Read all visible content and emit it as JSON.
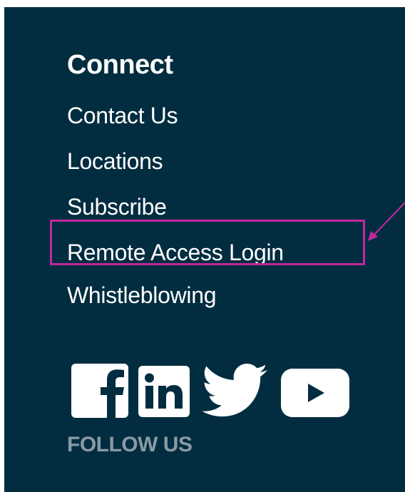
{
  "connect": {
    "heading": "Connect",
    "links": [
      {
        "label": "Contact Us"
      },
      {
        "label": "Locations"
      },
      {
        "label": "Subscribe"
      },
      {
        "label": "Remote Access Login"
      },
      {
        "label": "Whistleblowing"
      }
    ]
  },
  "social": {
    "icons": [
      "facebook-icon",
      "linkedin-icon",
      "twitter-icon",
      "youtube-icon"
    ],
    "follow_label": "FOLLOW US"
  },
  "annotation": {
    "highlight_color": "#c0289c",
    "highlighted_item": "Remote Access Login"
  },
  "colors": {
    "panel_bg": "#022d40",
    "text": "#ffffff",
    "muted_text": "#8a9aa4"
  }
}
